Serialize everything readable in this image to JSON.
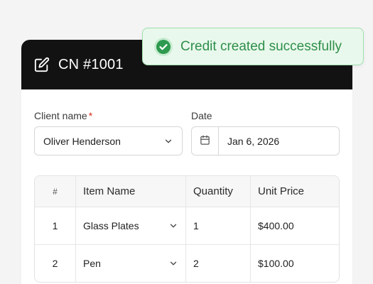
{
  "colors": {
    "header_bg": "#121212",
    "accent_success": "#2e8f4a",
    "toast_bg": "#e9f8ec",
    "required": "#d92d20"
  },
  "header": {
    "icon": "edit-icon",
    "title": "CN #1001"
  },
  "form": {
    "client": {
      "label": "Client name",
      "required_mark": "*",
      "value": "Oliver Henderson"
    },
    "date": {
      "label": "Date",
      "icon": "calendar-icon",
      "value": "Jan 6, 2026"
    }
  },
  "table": {
    "headers": {
      "num": "#",
      "item": "Item Name",
      "qty": "Quantity",
      "price": "Unit Price"
    },
    "rows": [
      {
        "num": "1",
        "item": "Glass Plates",
        "qty": "1",
        "price": "$400.00"
      },
      {
        "num": "2",
        "item": "Pen",
        "qty": "2",
        "price": "$100.00"
      }
    ]
  },
  "toast": {
    "icon": "check-circle-icon",
    "message": "Credit created successfully"
  }
}
